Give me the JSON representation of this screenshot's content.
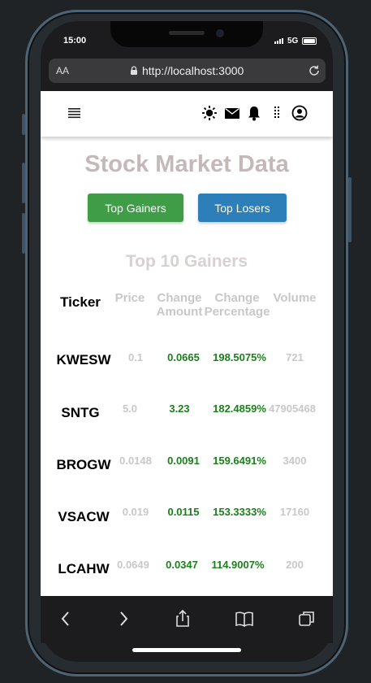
{
  "status": {
    "time": "15:00",
    "network": "5G"
  },
  "browser": {
    "text_size": "AA",
    "url": "http://localhost:3000"
  },
  "page": {
    "title": "Stock Market Data",
    "buttons": {
      "gainers": "Top Gainers",
      "losers": "Top Losers"
    },
    "subtitle": "Top 10 Gainers",
    "headers": {
      "ticker": "Ticker",
      "price": "Price",
      "change_amount": "Change Amount",
      "change_percentage": "Change Percentage",
      "volume": "Volume"
    },
    "rows": [
      {
        "ticker": "KWESW",
        "price": "0.1",
        "change_amount": "0.0665",
        "change_percentage": "198.5075%",
        "volume": "721"
      },
      {
        "ticker": "SNTG",
        "price": "5.0",
        "change_amount": "3.23",
        "change_percentage": "182.4859%",
        "volume": "47905468"
      },
      {
        "ticker": "BROGW",
        "price": "0.0148",
        "change_amount": "0.0091",
        "change_percentage": "159.6491%",
        "volume": "3400"
      },
      {
        "ticker": "VSACW",
        "price": "0.019",
        "change_amount": "0.0115",
        "change_percentage": "153.3333%",
        "volume": "17160"
      },
      {
        "ticker": "LCAHW",
        "price": "0.0649",
        "change_amount": "0.0347",
        "change_percentage": "114.9007%",
        "volume": "200"
      }
    ]
  },
  "icons": {
    "menu": "hamburger-icon",
    "theme": "sun-icon",
    "mail": "envelope-icon",
    "notifications": "bell-icon",
    "more": "vertical-dots-icon",
    "account": "user-circle-icon"
  },
  "colors": {
    "gainers_button": "#3f9c47",
    "losers_button": "#2c7fb8",
    "positive": "#1b7f1b",
    "title": "#c4b8b8"
  }
}
